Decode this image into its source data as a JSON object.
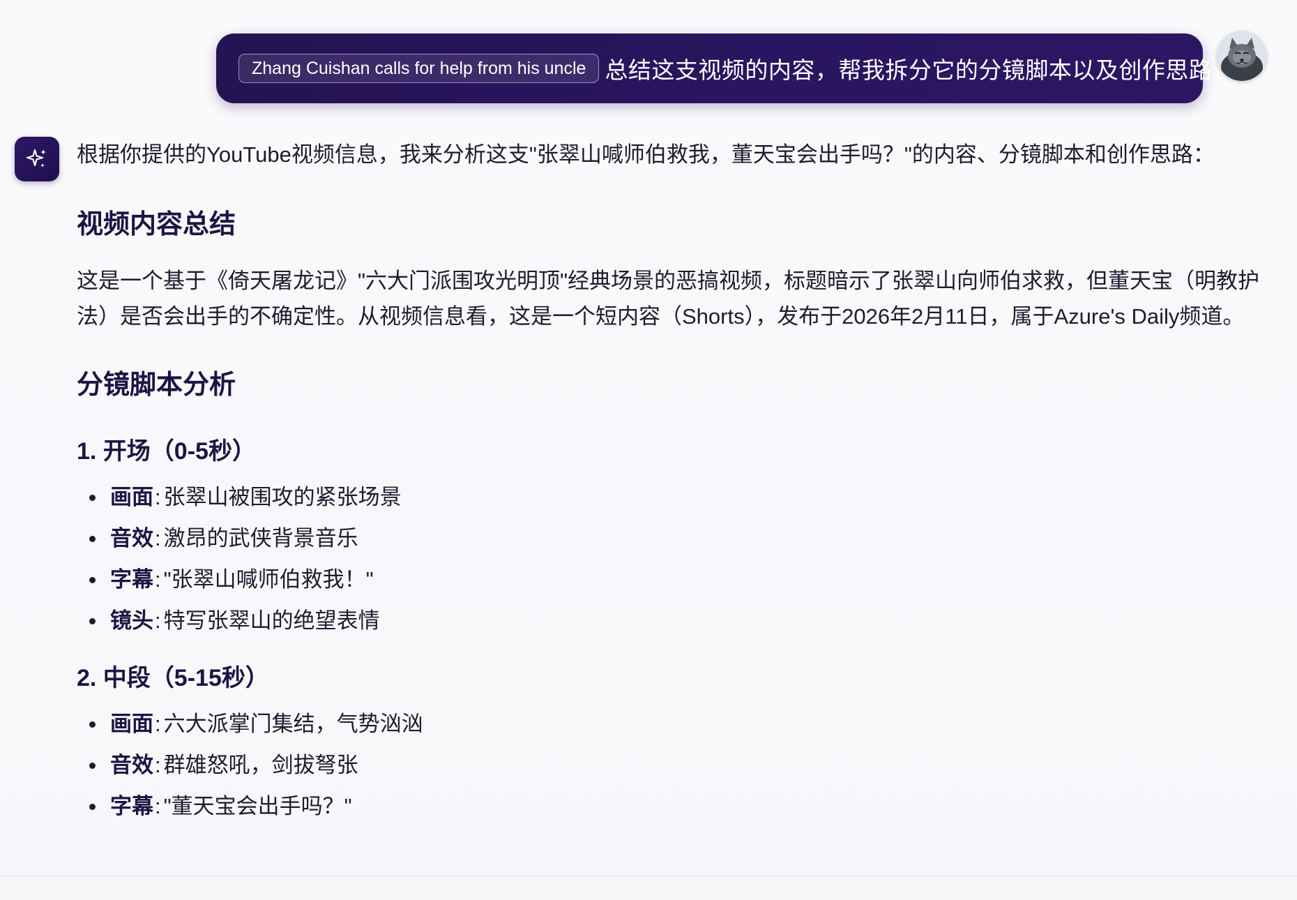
{
  "user_message": {
    "video_chip": "Zhang Cuishan calls for help from his uncle",
    "text": "总结这支视频的内容，帮我拆分它的分镜脚本以及创作思路"
  },
  "assistant": {
    "intro": "根据你提供的YouTube视频信息，我来分析这支\"张翠山喊师伯救我，董天宝会出手吗？\"的内容、分镜脚本和创作思路：",
    "summary_heading": "视频内容总结",
    "summary_text": "这是一个基于《倚天屠龙记》\"六大门派围攻光明顶\"经典场景的恶搞视频，标题暗示了张翠山向师伯求救，但董天宝（明教护法）是否会出手的不确定性。从视频信息看，这是一个短内容（Shorts），发布于2026年2月11日，属于Azure's Daily频道。",
    "storyboard_heading": "分镜脚本分析",
    "sections": [
      {
        "heading": "1. 开场（0-5秒）",
        "items": [
          {
            "label": "画面",
            "value": "张翠山被围攻的紧张场景"
          },
          {
            "label": "音效",
            "value": "激昂的武侠背景音乐"
          },
          {
            "label": "字幕",
            "value": "\"张翠山喊师伯救我！\""
          },
          {
            "label": "镜头",
            "value": "特写张翠山的绝望表情"
          }
        ]
      },
      {
        "heading": "2. 中段（5-15秒）",
        "items": [
          {
            "label": "画面",
            "value": "六大派掌门集结，气势汹汹"
          },
          {
            "label": "音效",
            "value": "群雄怒吼，剑拔弩张"
          },
          {
            "label": "字幕",
            "value": "\"董天宝会出手吗？\""
          }
        ]
      }
    ]
  },
  "icons": {
    "assistant": "sparkle-icon",
    "user": "cat-avatar"
  },
  "colors": {
    "bubble": "#2a1560",
    "accent": "#241453",
    "heading": "#1e1443"
  }
}
